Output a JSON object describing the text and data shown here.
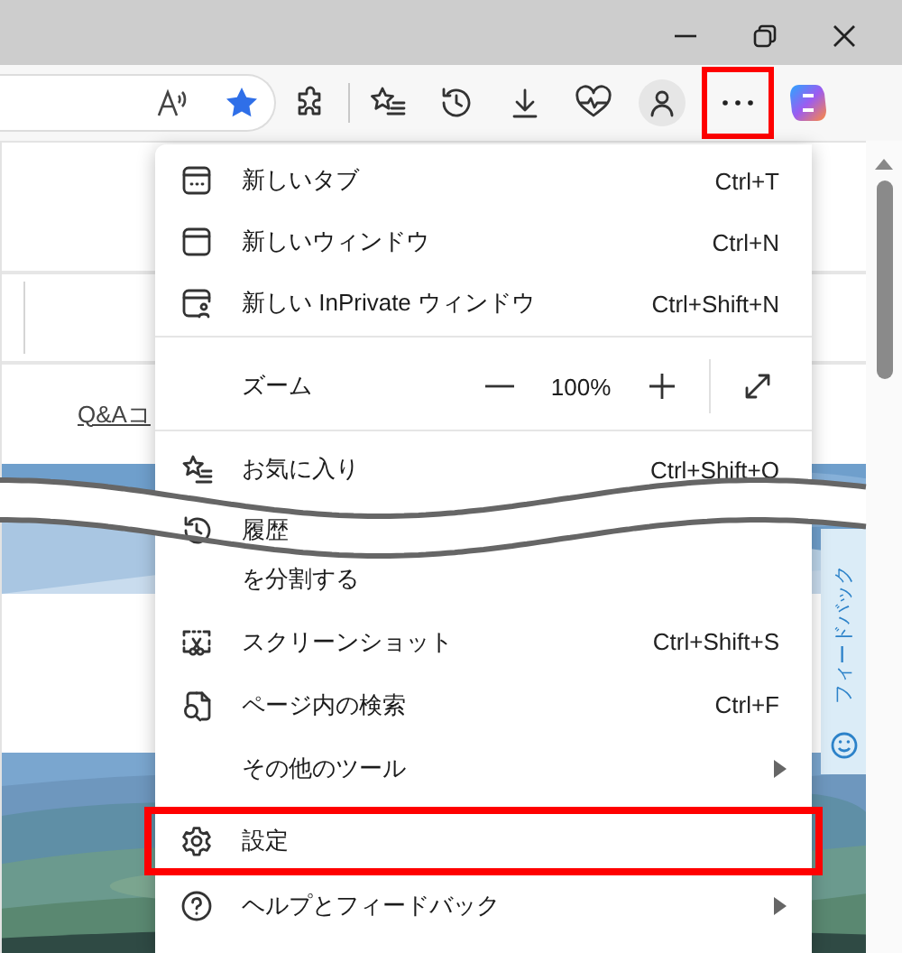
{
  "toolbar": {
    "more_button": {
      "highlighted": true
    }
  },
  "page": {
    "link": "Q&Aコ",
    "feedback": "フィードバック"
  },
  "menu": {
    "items": [
      {
        "kind": "item",
        "label": "新しいタブ",
        "shortcut": "Ctrl+T",
        "submenu": false,
        "highlighted": false
      },
      {
        "kind": "item",
        "label": "新しいウィンドウ",
        "shortcut": "Ctrl+N",
        "submenu": false,
        "highlighted": false
      },
      {
        "kind": "item",
        "label": "新しい InPrivate ウィンドウ",
        "shortcut": "Ctrl+Shift+N",
        "submenu": false,
        "highlighted": false
      },
      {
        "kind": "divider"
      },
      {
        "kind": "zoom",
        "label": "ズーム",
        "value": "100%"
      },
      {
        "kind": "divider"
      },
      {
        "kind": "item",
        "label": "お気に入り",
        "shortcut": "Ctrl+Shift+O",
        "submenu": false,
        "highlighted": false
      },
      {
        "kind": "item",
        "label": "履歴",
        "submenu": false,
        "highlighted": false
      },
      {
        "kind": "item",
        "label": "を分割する",
        "submenu": false,
        "highlighted": false
      },
      {
        "kind": "item",
        "label": "スクリーンショット",
        "shortcut": "Ctrl+Shift+S",
        "submenu": false,
        "highlighted": false
      },
      {
        "kind": "item",
        "label": "ページ内の検索",
        "shortcut": "Ctrl+F",
        "submenu": false,
        "highlighted": false
      },
      {
        "kind": "item",
        "label": "その他のツール",
        "submenu": true,
        "highlighted": false
      },
      {
        "kind": "item",
        "label": "設定",
        "submenu": false,
        "highlighted": true
      },
      {
        "kind": "item",
        "label": "ヘルプとフィードバック",
        "submenu": true,
        "highlighted": false
      }
    ]
  }
}
